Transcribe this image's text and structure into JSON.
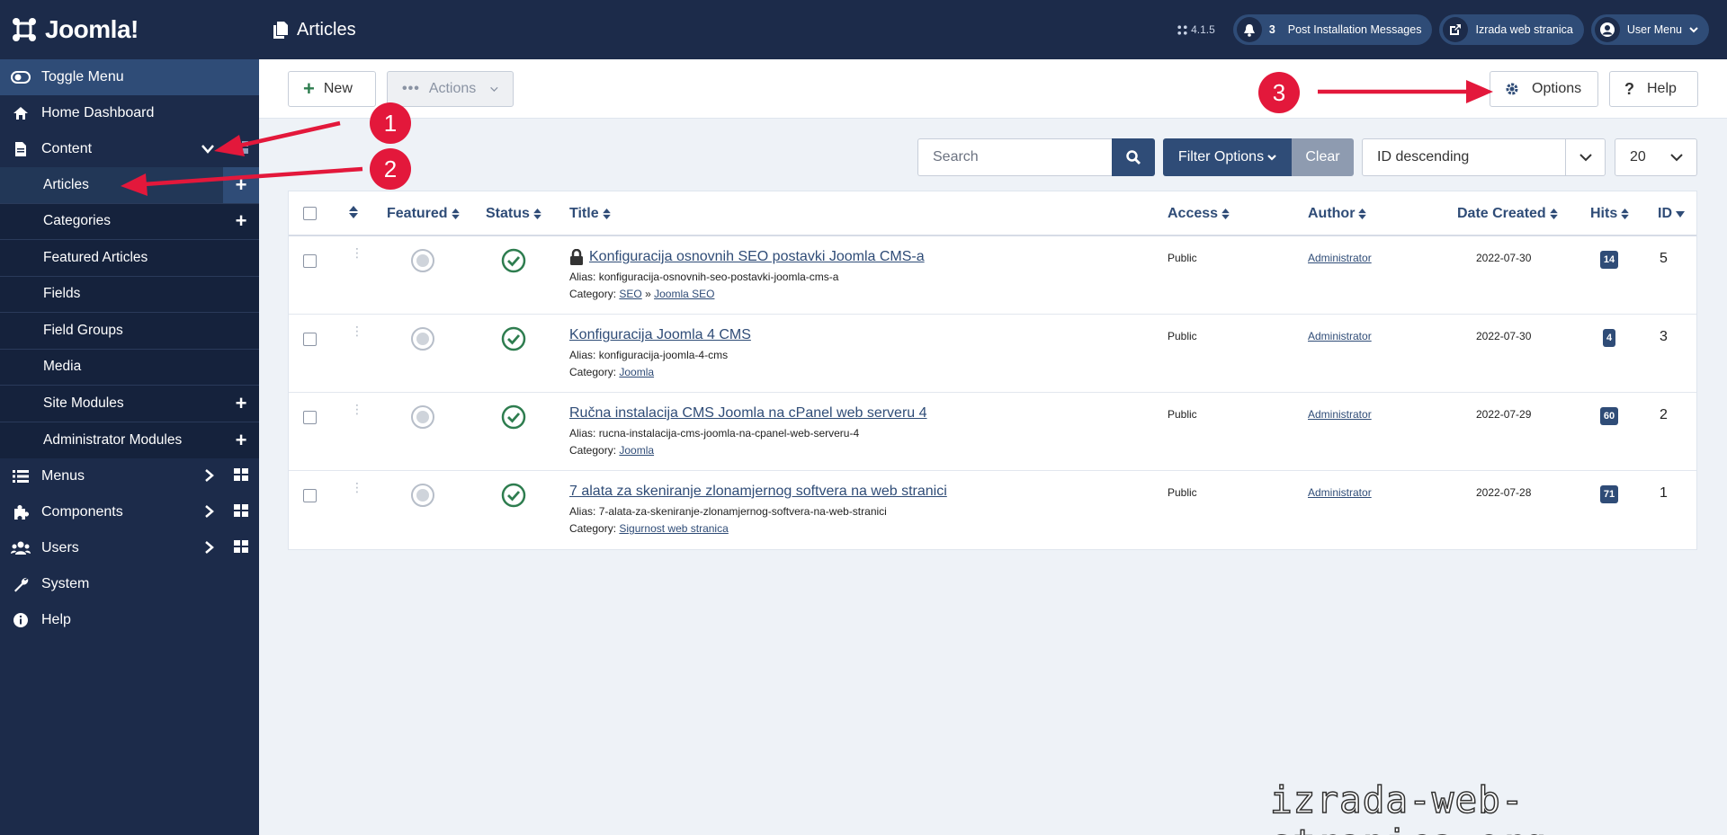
{
  "brand": {
    "name": "Joomla!"
  },
  "header": {
    "title": "Articles",
    "version": "4.1.5",
    "notifications_count": "3",
    "post_install_label": "Post Installation Messages",
    "site_label": "Izrada web stranica",
    "user_menu_label": "User Menu"
  },
  "sidebar": {
    "toggle_label": "Toggle Menu",
    "items": [
      {
        "label": "Home Dashboard"
      },
      {
        "label": "Content"
      },
      {
        "label": "Menus"
      },
      {
        "label": "Components"
      },
      {
        "label": "Users"
      },
      {
        "label": "System"
      },
      {
        "label": "Help"
      }
    ],
    "content_sub": [
      {
        "label": "Articles"
      },
      {
        "label": "Categories"
      },
      {
        "label": "Featured Articles"
      },
      {
        "label": "Fields"
      },
      {
        "label": "Field Groups"
      },
      {
        "label": "Media"
      },
      {
        "label": "Site Modules"
      },
      {
        "label": "Administrator Modules"
      }
    ]
  },
  "toolbar": {
    "new_label": "New",
    "actions_label": "Actions",
    "options_label": "Options",
    "help_label": "Help"
  },
  "filters": {
    "search_placeholder": "Search",
    "filter_options_label": "Filter Options",
    "clear_label": "Clear",
    "ordering_value": "ID descending",
    "limit_value": "20"
  },
  "table": {
    "columns": {
      "featured": "Featured",
      "status": "Status",
      "title": "Title",
      "access": "Access",
      "author": "Author",
      "date_created": "Date Created",
      "hits": "Hits",
      "id": "ID"
    },
    "alias_prefix": "Alias:",
    "category_prefix": "Category:",
    "rows": [
      {
        "title": "Konfiguracija osnovnih SEO postavki Joomla CMS-a",
        "alias": "konfiguracija-osnovnih-seo-postavki-joomla-cms-a",
        "category_parent": "SEO",
        "category_sep": "»",
        "category": "Joomla SEO",
        "access": "Public",
        "author": "Administrator",
        "date": "2022-07-30",
        "hits": "14",
        "id": "5"
      },
      {
        "title": "Konfiguracija Joomla 4 CMS",
        "alias": "konfiguracija-joomla-4-cms",
        "category": "Joomla",
        "access": "Public",
        "author": "Administrator",
        "date": "2022-07-30",
        "hits": "4",
        "id": "3"
      },
      {
        "title": "Ručna instalacija CMS Joomla na cPanel web serveru 4",
        "alias": "rucna-instalacija-cms-joomla-na-cpanel-web-serveru-4",
        "category": "Joomla",
        "access": "Public",
        "author": "Administrator",
        "date": "2022-07-29",
        "hits": "60",
        "id": "2"
      },
      {
        "title": "7 alata za skeniranje zlonamjernog softvera na web stranici",
        "alias": "7-alata-za-skeniranje-zlonamjernog-softvera-na-web-stranici",
        "category": "Sigurnost web stranica",
        "access": "Public",
        "author": "Administrator",
        "date": "2022-07-28",
        "hits": "71",
        "id": "1"
      }
    ]
  },
  "annotations": {
    "one": "1",
    "two": "2",
    "three": "3"
  },
  "watermark": "izrada-web-stranica.org",
  "colors": {
    "sidebar_bg": "#1c2b4a",
    "accent": "#2f4c77",
    "annotation_red": "#e3183b",
    "status_green": "#2e7d4f"
  }
}
